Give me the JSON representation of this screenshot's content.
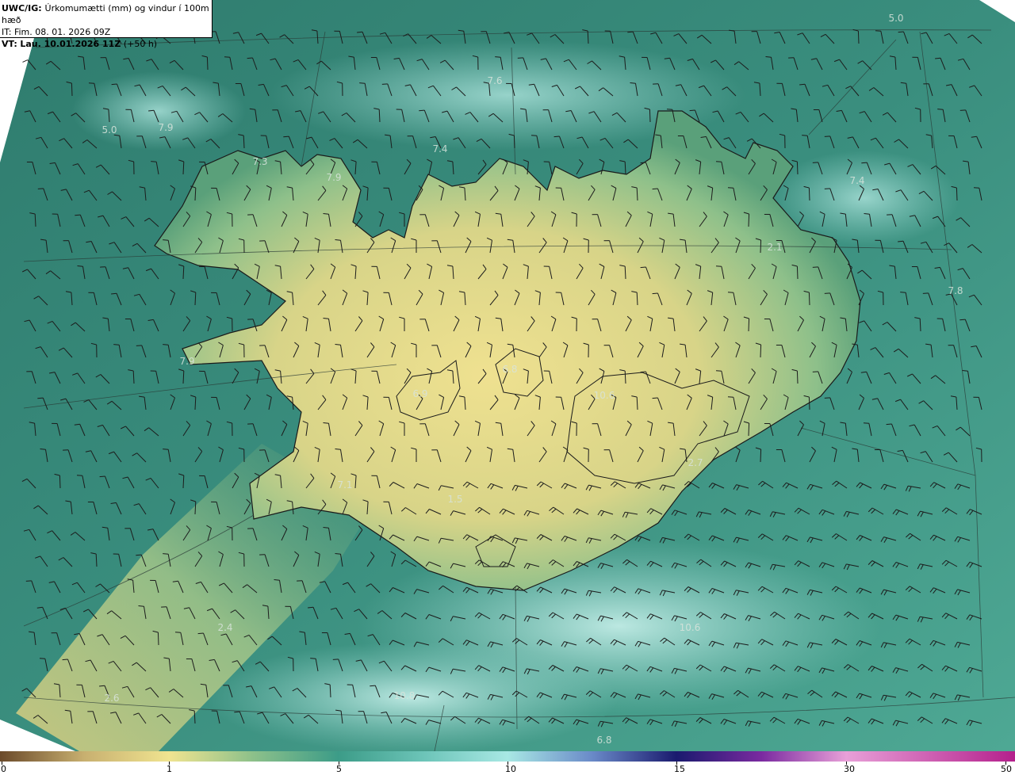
{
  "header": {
    "product": "UWC/IG:",
    "title": "Úrkomumætti (mm) og vindur í 100m hæð",
    "it_line": "IT: Fim. 08. 01. 2026 09Z",
    "vt_prefix": "VT:",
    "vt_bold": "Lau. 10.01.2026 11Z",
    "vt_suffix": "(+50 h)"
  },
  "colorbar": {
    "ticks": [
      "0",
      "1",
      "5",
      "10",
      "15",
      "30",
      "50"
    ],
    "colors": {
      "brown": "#6b4a2a",
      "tan": "#c8b070",
      "yellow": "#f0e490",
      "teal": "#3c9c88",
      "cyan": "#a8e8e4",
      "navy": "#1a1a6e",
      "purple": "#7a2aa0",
      "pink": "#e8a0d8",
      "magenta": "#b4208c"
    }
  },
  "map": {
    "colors": {
      "sea_dark": "#2f7f72",
      "sea_mid": "#3e9584",
      "sea_light": "#8fd2c8",
      "land_green": "#6aaa7e",
      "land_yellow": "#e6dc8a",
      "coast": "#1a1a1a",
      "barb": "#1c1c1c"
    },
    "value_labels": [
      "5.0",
      "7.6",
      "5.0",
      "7.9",
      "7.4",
      "7.3",
      "7.9",
      "7.4",
      "7.8",
      "2.1",
      "7.9",
      "6.9",
      "6.8",
      "10.6",
      "2.7",
      "1.5",
      "2.4",
      "10.8",
      "2.6",
      "10.6",
      "6.8",
      "7.1"
    ]
  }
}
